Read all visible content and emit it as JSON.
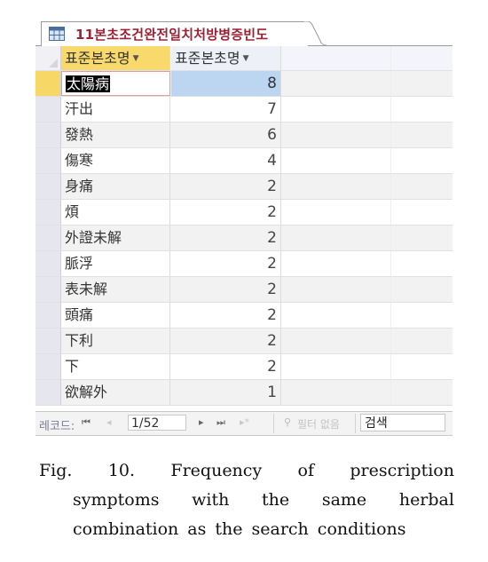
{
  "tab": {
    "title": "11본초조건완전일치처방병증빈도",
    "icon": "table-icon"
  },
  "columns": [
    "표준본초명",
    "표준본초명"
  ],
  "rows": [
    {
      "name": "太陽病",
      "count": "8"
    },
    {
      "name": "汗出",
      "count": "7"
    },
    {
      "name": "發熱",
      "count": "6"
    },
    {
      "name": "傷寒",
      "count": "4"
    },
    {
      "name": "身痛",
      "count": "2"
    },
    {
      "name": "煩",
      "count": "2"
    },
    {
      "name": "外證未解",
      "count": "2"
    },
    {
      "name": "脈浮",
      "count": "2"
    },
    {
      "name": "表未解",
      "count": "2"
    },
    {
      "name": "頭痛",
      "count": "2"
    },
    {
      "name": "下利",
      "count": "2"
    },
    {
      "name": "下",
      "count": "2"
    },
    {
      "name": "欲解外",
      "count": "1"
    }
  ],
  "navigation": {
    "record_label": "레코드:",
    "first_icon": "⏮",
    "prev_icon": "◂",
    "current_record": "1/52",
    "next_icon": "▸",
    "last_icon": "⏭",
    "new_icon": "▸*",
    "filter_label": "필터 없음",
    "search_placeholder": "검색"
  },
  "caption": {
    "line1": [
      "Fig.",
      "10.",
      "Frequency",
      "of",
      "prescription"
    ],
    "line2": [
      "symptoms",
      "with",
      "the",
      "same",
      "herbal"
    ],
    "line3": [
      "combination",
      "as",
      "the",
      "search",
      "conditions"
    ]
  }
}
